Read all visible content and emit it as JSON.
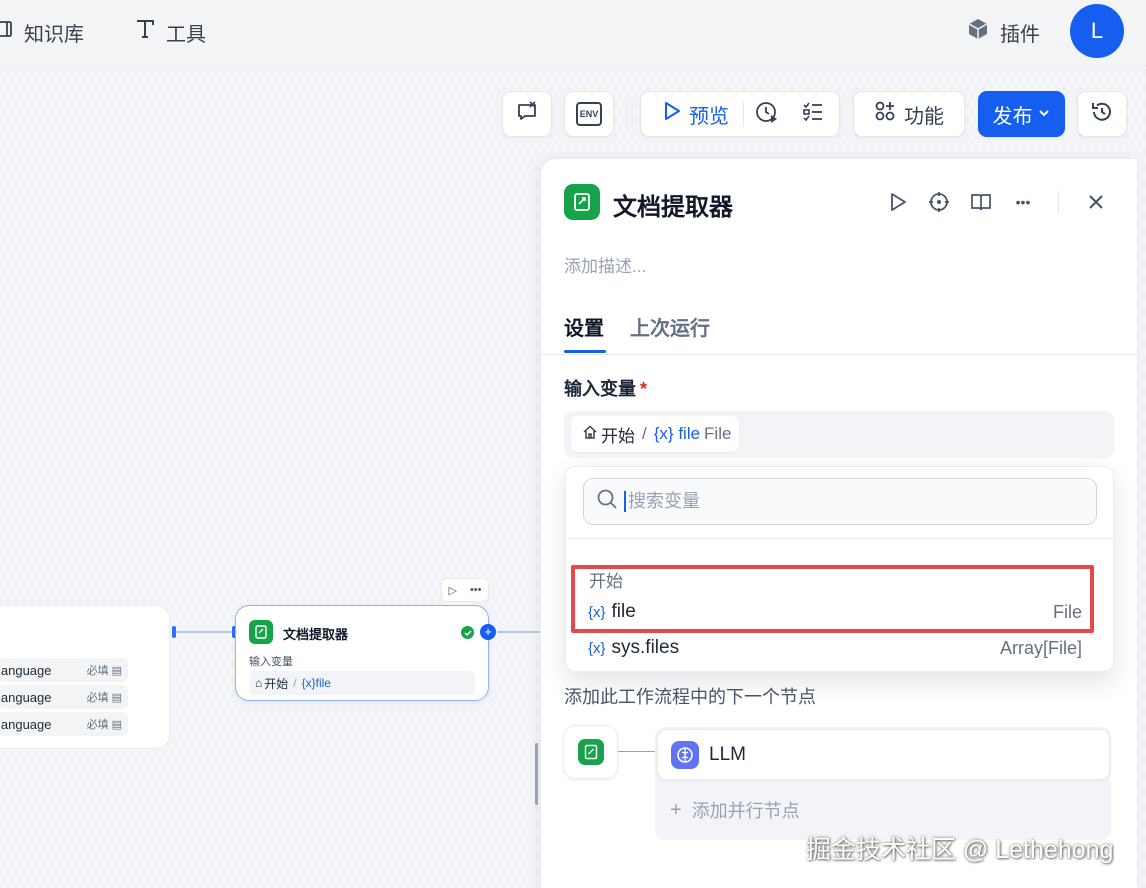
{
  "topnav": {
    "knowledge_label": "知识库",
    "tools_label": "工具",
    "plugins_label": "插件",
    "avatar_letter": "L"
  },
  "toolbar": {
    "check_icon": "checklist-x-icon",
    "env_label": "ENV",
    "preview_label": "预览",
    "features_label": "功能",
    "publish_label": "发布"
  },
  "canvas": {
    "left_node_rows": [
      {
        "name": "language",
        "required": "必填"
      },
      {
        "name": "language",
        "required": "必填"
      }
    ],
    "doc_node": {
      "title": "文档提取器",
      "input_label": "输入变量",
      "source": "开始",
      "var": "{x}file"
    }
  },
  "panel": {
    "title": "文档提取器",
    "description_placeholder": "添加描述...",
    "tabs": [
      "设置",
      "上次运行"
    ],
    "input_label": "输入变量",
    "required_mark": "*",
    "selected_var": {
      "node": "开始",
      "separator": "/",
      "var": "{x} file",
      "type": "File"
    },
    "dropdown": {
      "search_placeholder": "搜索变量",
      "group": "开始",
      "items": [
        {
          "icon": "{x}",
          "name": "file",
          "type": "File"
        },
        {
          "icon": "{x}",
          "name": "sys.files",
          "type": "Array[File]"
        }
      ]
    },
    "next_step": {
      "description": "添加此工作流程中的下一个节点",
      "llm_label": "LLM",
      "add_parallel": "添加并行节点"
    }
  },
  "watermark": "掘金技术社区 @ Lethehong",
  "colors": {
    "accent": "#155eef",
    "highlight": "#e5484d",
    "node_green": "#16a34a"
  }
}
